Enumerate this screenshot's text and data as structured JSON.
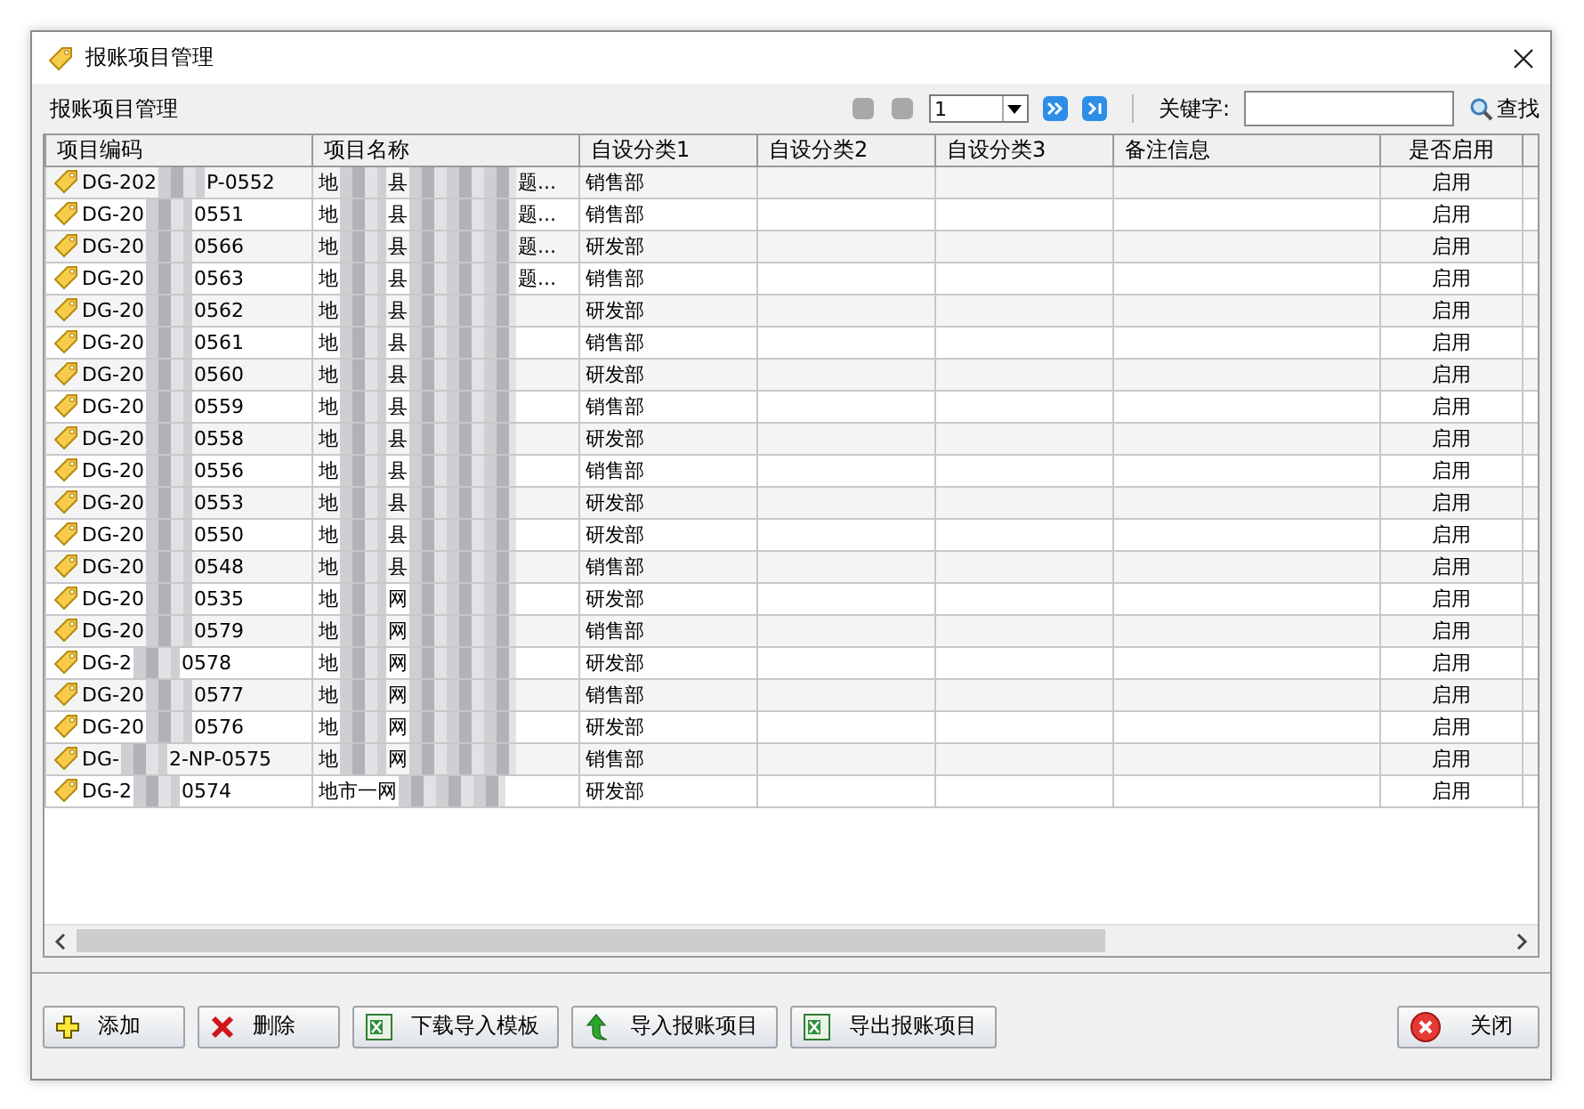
{
  "window": {
    "title": "报账项目管理"
  },
  "panel_title": "报账项目管理",
  "pager": {
    "page": "1",
    "keyword_label": "关键字:",
    "search": "查找"
  },
  "table": {
    "columns": [
      "项目编码",
      "项目名称",
      "自设分类1",
      "自设分类2",
      "自设分类3",
      "备注信息",
      "是否启用"
    ],
    "rows": [
      {
        "code": [
          "DG-202",
          "P-0552"
        ],
        "name": [
          "地",
          "县",
          "题..."
        ],
        "cat1": "销售部",
        "enabled": "启用"
      },
      {
        "code": [
          "DG-20",
          "0551"
        ],
        "name": [
          "地",
          "县",
          "题..."
        ],
        "cat1": "销售部",
        "enabled": "启用"
      },
      {
        "code": [
          "DG-20",
          "0566"
        ],
        "name": [
          "地",
          "县",
          "题..."
        ],
        "cat1": "研发部",
        "enabled": "启用"
      },
      {
        "code": [
          "DG-20",
          "0563"
        ],
        "name": [
          "地",
          "县",
          "题..."
        ],
        "cat1": "销售部",
        "enabled": "启用"
      },
      {
        "code": [
          "DG-20",
          "0562"
        ],
        "name": [
          "地",
          "县"
        ],
        "cat1": "研发部",
        "enabled": "启用"
      },
      {
        "code": [
          "DG-20",
          "0561"
        ],
        "name": [
          "地",
          "县"
        ],
        "cat1": "销售部",
        "enabled": "启用"
      },
      {
        "code": [
          "DG-20",
          "0560"
        ],
        "name": [
          "地",
          "县"
        ],
        "cat1": "研发部",
        "enabled": "启用"
      },
      {
        "code": [
          "DG-20",
          "0559"
        ],
        "name": [
          "地",
          "县"
        ],
        "cat1": "销售部",
        "enabled": "启用"
      },
      {
        "code": [
          "DG-20",
          "0558"
        ],
        "name": [
          "地",
          "县"
        ],
        "cat1": "研发部",
        "enabled": "启用"
      },
      {
        "code": [
          "DG-20",
          "0556"
        ],
        "name": [
          "地",
          "县"
        ],
        "cat1": "销售部",
        "enabled": "启用"
      },
      {
        "code": [
          "DG-20",
          "0553"
        ],
        "name": [
          "地",
          "县"
        ],
        "cat1": "研发部",
        "enabled": "启用"
      },
      {
        "code": [
          "DG-20",
          "0550"
        ],
        "name": [
          "地",
          "县"
        ],
        "cat1": "研发部",
        "enabled": "启用"
      },
      {
        "code": [
          "DG-20",
          "0548"
        ],
        "name": [
          "地",
          "县"
        ],
        "cat1": "销售部",
        "enabled": "启用"
      },
      {
        "code": [
          "DG-20",
          "0535"
        ],
        "name": [
          "地",
          "网"
        ],
        "cat1": "研发部",
        "enabled": "启用"
      },
      {
        "code": [
          "DG-20",
          "0579"
        ],
        "name": [
          "地",
          "网"
        ],
        "cat1": "销售部",
        "enabled": "启用"
      },
      {
        "code": [
          "DG-2",
          "0578"
        ],
        "name": [
          "地",
          "网"
        ],
        "cat1": "研发部",
        "enabled": "启用"
      },
      {
        "code": [
          "DG-20",
          "0577"
        ],
        "name": [
          "地",
          "网"
        ],
        "cat1": "销售部",
        "enabled": "启用"
      },
      {
        "code": [
          "DG-20",
          "0576"
        ],
        "name": [
          "地",
          "网"
        ],
        "cat1": "研发部",
        "enabled": "启用"
      },
      {
        "code": [
          "DG-",
          "2-NP-0575"
        ],
        "name": [
          "地",
          "网"
        ],
        "cat1": "销售部",
        "enabled": "启用"
      },
      {
        "code": [
          "DG-2",
          "0574"
        ],
        "name": [
          "地市一网"
        ],
        "cat1": "研发部",
        "enabled": "启用"
      }
    ]
  },
  "buttons": [
    {
      "kind": "add",
      "label": "添加"
    },
    {
      "kind": "delete",
      "label": "删除"
    },
    {
      "kind": "excel",
      "label": "下载导入模板"
    },
    {
      "kind": "import",
      "label": "导入报账项目"
    },
    {
      "kind": "excel",
      "label": "导出报账项目"
    }
  ],
  "close_button": {
    "kind": "close",
    "label": "关闭"
  }
}
